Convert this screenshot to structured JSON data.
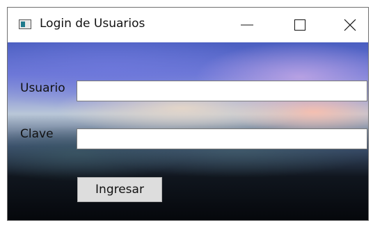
{
  "window": {
    "title": "Login de Usuarios"
  },
  "form": {
    "user_label": "Usuario",
    "user_value": "",
    "password_label": "Clave",
    "password_value": "",
    "submit_label": "Ingresar"
  },
  "icons": {
    "app": "app-window-icon",
    "minimize": "minimize-icon",
    "maximize": "maximize-icon",
    "close": "close-icon"
  }
}
